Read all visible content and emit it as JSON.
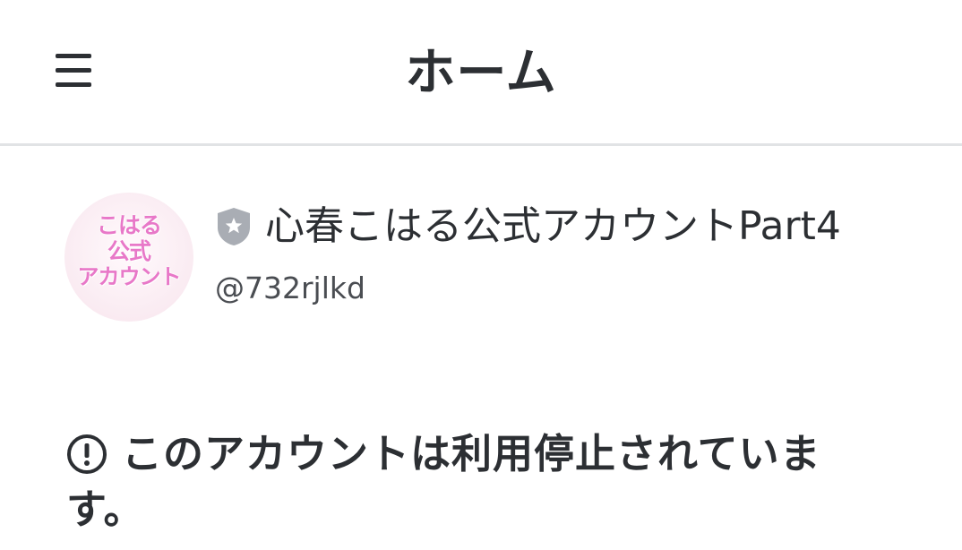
{
  "header": {
    "title": "ホーム",
    "menu_icon": "hamburger-menu-icon"
  },
  "profile": {
    "avatar_text": {
      "line1": "こはる",
      "line2": "公式",
      "line3": "アカウント"
    },
    "badge_icon": "shield-star-icon",
    "display_name": "心春こはる公式アカウントPart4",
    "handle": "@732rjlkd"
  },
  "notice": {
    "icon": "exclamation-circle-icon",
    "message": "このアカウントは利用停止されています。"
  },
  "colors": {
    "text": "#2c2f33",
    "divider": "#e1e3e5",
    "avatar_accent": "#e878c8",
    "badge": "#a9adb4"
  }
}
